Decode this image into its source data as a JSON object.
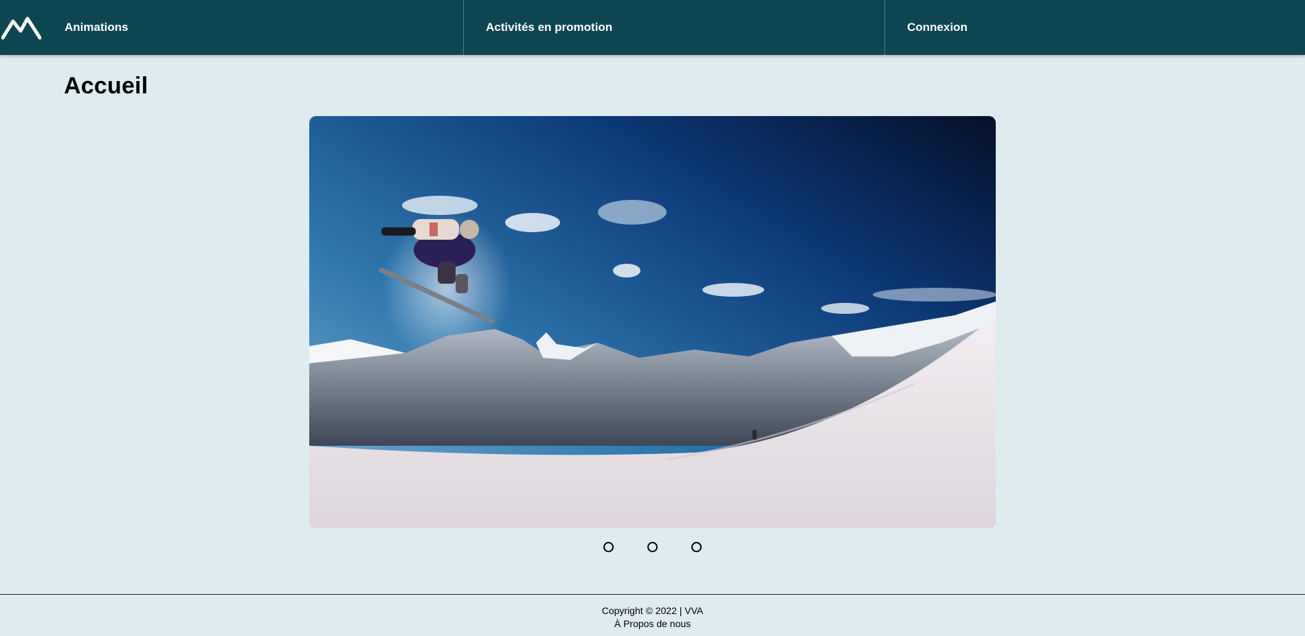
{
  "nav": {
    "logo_icon": "mountain-logo-icon",
    "items": [
      {
        "label": "Animations"
      },
      {
        "label": "Activités en promotion"
      },
      {
        "label": "Connexion"
      }
    ]
  },
  "page": {
    "title": "Accueil"
  },
  "carousel": {
    "slide_count": 3,
    "active_slide": 1,
    "image_subject": "snowboarder-jump-mountain-photo"
  },
  "footer": {
    "copyright": "Copyright © 2022 | VVA",
    "about_link": "À Propos de nous"
  },
  "colors": {
    "navbar": "#0d4652",
    "background": "#deebef",
    "nav_text": "#ffffff"
  }
}
